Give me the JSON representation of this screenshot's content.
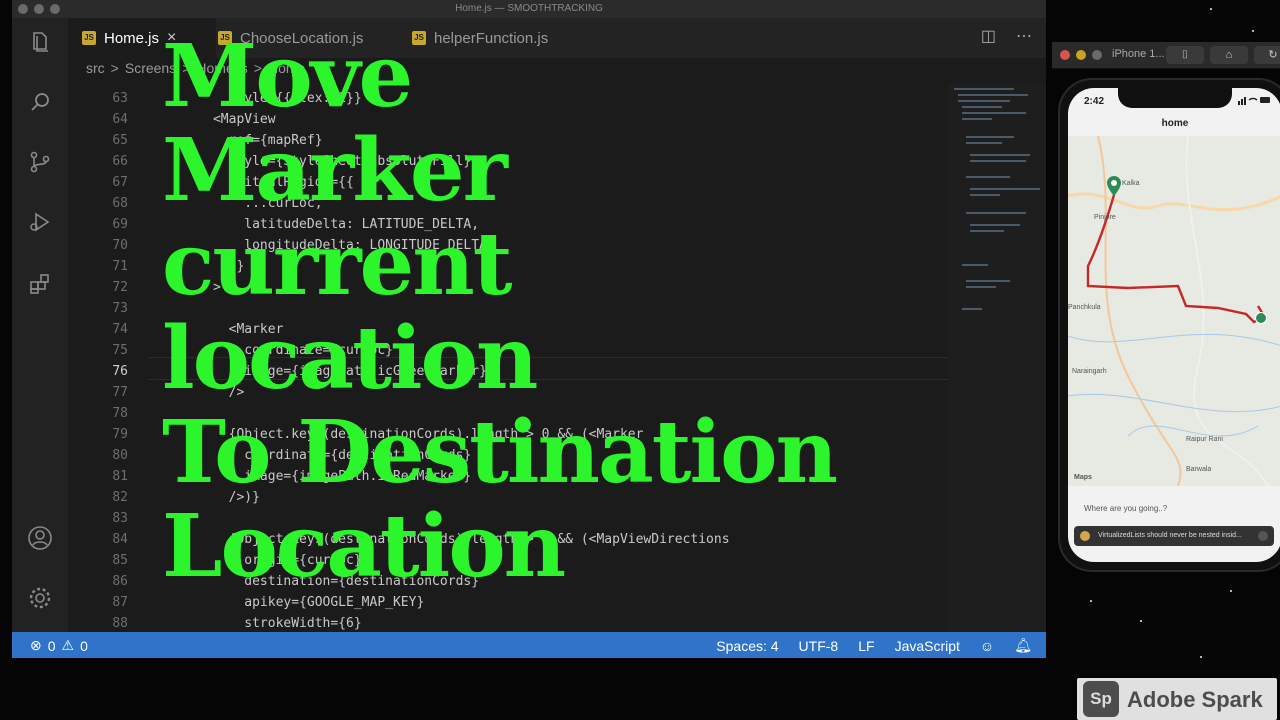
{
  "window": {
    "title": "Home.js — SMOOTHTRACKING"
  },
  "tabs": [
    {
      "label": "Home.js",
      "icon": "JS"
    },
    {
      "label": "ChooseLocation.js",
      "icon": "JS"
    },
    {
      "label": "helperFunction.js",
      "icon": "JS"
    }
  ],
  "breadcrumb": [
    "src",
    ">",
    "Screens",
    ">",
    "Home.js",
    ">",
    "Home"
  ],
  "code": {
    "lines": [
      {
        "n": "63",
        "text": "        style={{flex: 1}}"
      },
      {
        "n": "64",
        "text": "      <MapView"
      },
      {
        "n": "65",
        "text": "        ref={mapRef}"
      },
      {
        "n": "66",
        "text": "        style={StyleSheet.absoluteFill}"
      },
      {
        "n": "67",
        "text": "        initialRegion={{"
      },
      {
        "n": "68",
        "text": "          ...curLoc,"
      },
      {
        "n": "69",
        "text": "          latitudeDelta: LATITUDE_DELTA,"
      },
      {
        "n": "70",
        "text": "          longitudeDelta: LONGITUDE_DELTA,"
      },
      {
        "n": "71",
        "text": "        }}"
      },
      {
        "n": "72",
        "text": "      >"
      },
      {
        "n": "73",
        "text": ""
      },
      {
        "n": "74",
        "text": "        <Marker"
      },
      {
        "n": "75",
        "text": "          coordinate={curLoc}"
      },
      {
        "n": "76",
        "text": "          image={imagePath.icGreenMarker}"
      },
      {
        "n": "77",
        "text": "        />"
      },
      {
        "n": "78",
        "text": ""
      },
      {
        "n": "79",
        "text": "        {Object.keys(destinationCords).length > 0 && (<Marker"
      },
      {
        "n": "80",
        "text": "          coordinate={destinationCords}"
      },
      {
        "n": "81",
        "text": "          image={imagePath.icRedMarker}"
      },
      {
        "n": "82",
        "text": "        />)}"
      },
      {
        "n": "83",
        "text": ""
      },
      {
        "n": "84",
        "text": "        {Object.keys(destinationCords).length > 0 && (<MapViewDirections"
      },
      {
        "n": "85",
        "text": "          origin={curLoc}"
      },
      {
        "n": "86",
        "text": "          destination={destinationCords}"
      },
      {
        "n": "87",
        "text": "          apikey={GOOGLE_MAP_KEY}"
      },
      {
        "n": "88",
        "text": "          strokeWidth={6}"
      }
    ]
  },
  "overlay": {
    "lines": [
      "Move",
      "Marker",
      "current",
      "location",
      "To Destination",
      "Location"
    ]
  },
  "statusbar": {
    "errors": "0",
    "warnings": "0",
    "spaces": "Spaces: 4",
    "encoding": "UTF-8",
    "eol": "LF",
    "language": "JavaScript"
  },
  "simulator": {
    "title": "iPhone 1...",
    "time": "2:42",
    "nav_title": "home",
    "map_labels": [
      "Pinjore",
      "Panchkula",
      "Naraingarh",
      "Raipur Rani",
      "Barwala",
      "Maps",
      "Kalka"
    ],
    "where_label": "Where are you going..?",
    "toast": "VirtualizedLists should never be nested insid..."
  },
  "watermark": {
    "logo": "Sp",
    "text": "Adobe Spark"
  },
  "colors": {
    "overlay_text": "#2cf52c",
    "statusbar": "#2f74c8",
    "route": "#c62828",
    "marker": "#2e8b57"
  }
}
